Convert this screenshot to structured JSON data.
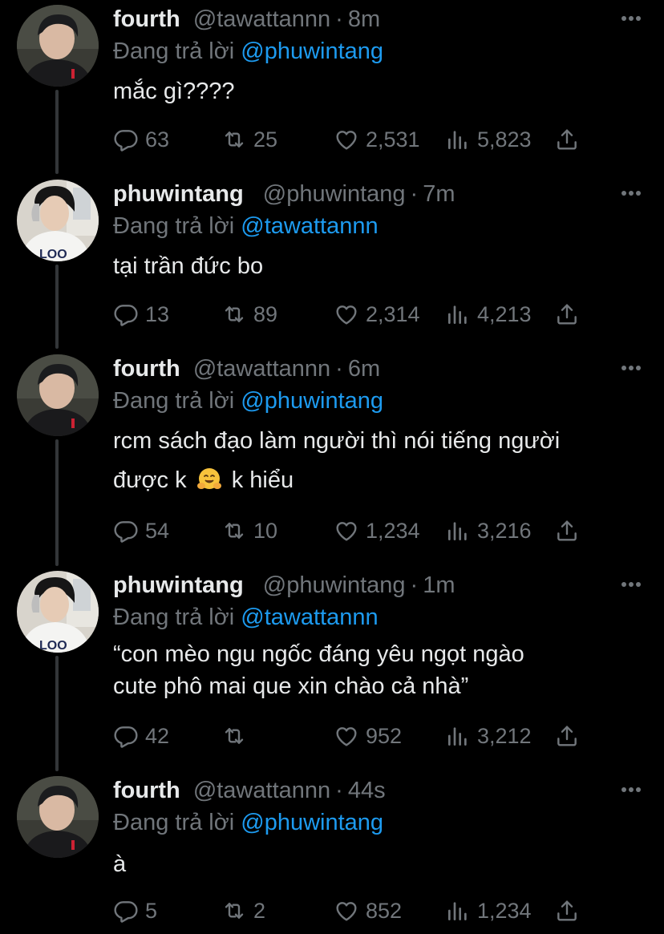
{
  "reply_prefix": "Đang trả lời",
  "icons": {
    "reply": "reply-bubble-icon",
    "retweet": "retweet-icon",
    "like": "heart-icon",
    "views": "views-chart-icon",
    "share": "share-upload-icon",
    "more": "more-options-icon",
    "emoji": "hugging-face-emoji"
  },
  "colors": {
    "mention": "#1d9bf0",
    "secondary": "#71767b",
    "text": "#e7e9ea",
    "background": "#000000"
  },
  "tweets": [
    {
      "name": "fourth",
      "handle": "@tawattannn",
      "time": "8m",
      "reply_to": "@phuwintang",
      "body": "mắc gì????",
      "replies": "63",
      "retweets": "25",
      "likes": "2,531",
      "views": "5,823"
    },
    {
      "name": "phuwintang",
      "handle": "@phuwintang",
      "time": "7m",
      "reply_to": "@tawattannn",
      "body": "tại trần đức bo",
      "replies": "13",
      "retweets": "89",
      "likes": "2,314",
      "views": "4,213"
    },
    {
      "name": "fourth",
      "handle": "@tawattannn",
      "time": "6m",
      "reply_to": "@phuwintang",
      "body_line1": "rcm sách đạo làm người thì nói tiếng người",
      "body_line2a": "được k",
      "body_line2b": "k hiểu",
      "replies": "54",
      "retweets": "10",
      "likes": "1,234",
      "views": "3,216"
    },
    {
      "name": "phuwintang",
      "handle": "@phuwintang",
      "time": "1m",
      "reply_to": "@tawattannn",
      "body": "“con mèo ngu ngốc đáng yêu ngọt ngào\ncute phô mai que xin chào cả nhà”",
      "replies": "42",
      "retweets": "",
      "likes": "952",
      "views": "3,212"
    },
    {
      "name": "fourth",
      "handle": "@tawattannn",
      "time": "44s",
      "reply_to": "@phuwintang",
      "body": "à",
      "replies": "5",
      "retweets": "2",
      "likes": "852",
      "views": "1,234"
    }
  ]
}
